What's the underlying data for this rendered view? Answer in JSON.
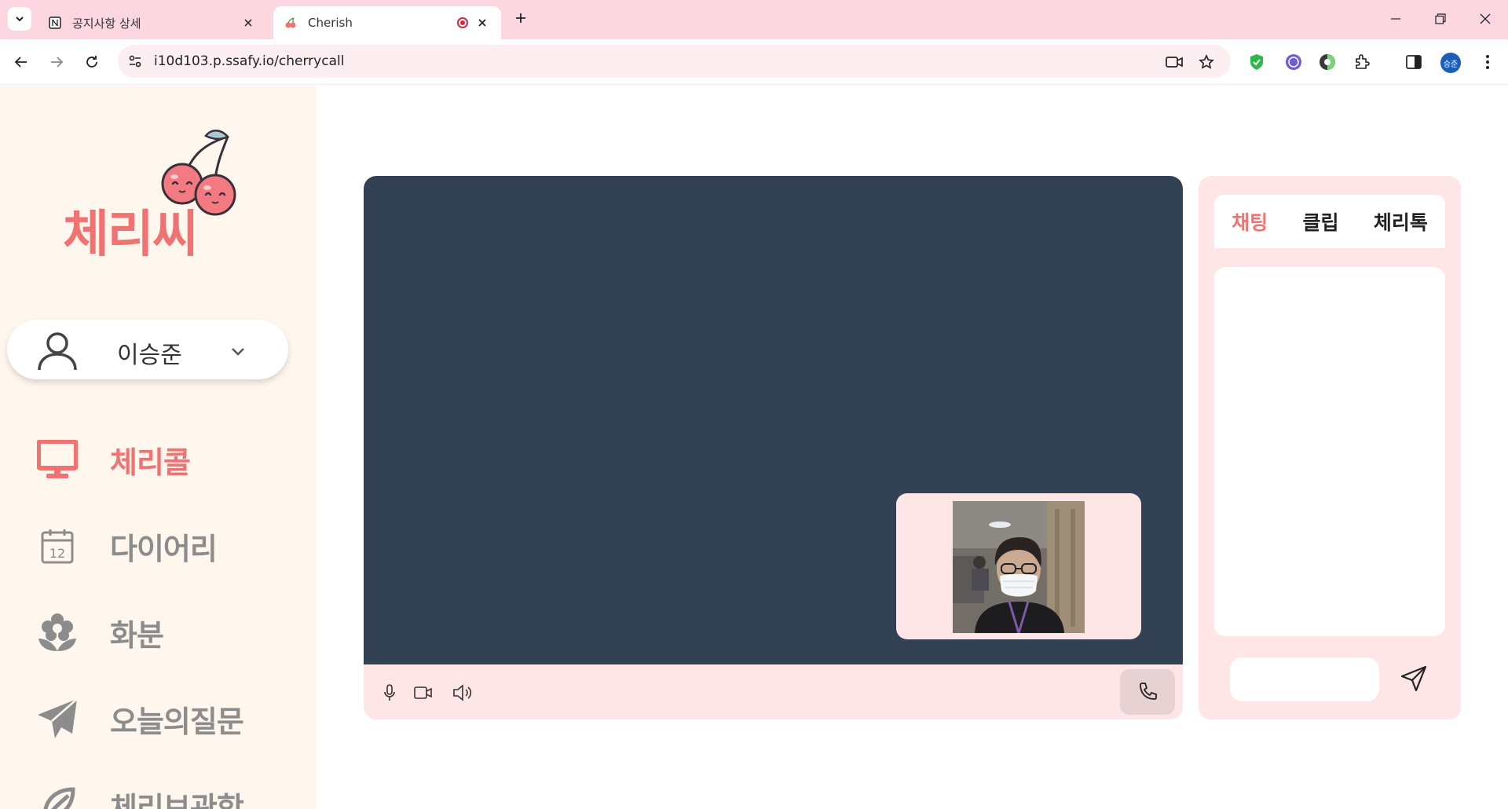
{
  "browser": {
    "tabs": [
      {
        "title": "공지사항 상세",
        "active": false
      },
      {
        "title": "Cherish",
        "active": true
      }
    ],
    "url": "i10d103.p.ssafy.io/cherrycall",
    "profile_initials": "승준"
  },
  "sidebar": {
    "logo_text": "체리씨",
    "user_name": "이승준",
    "nav": [
      {
        "label": "체리콜",
        "icon": "monitor-icon",
        "active": true
      },
      {
        "label": "다이어리",
        "icon": "calendar-icon",
        "active": false
      },
      {
        "label": "화분",
        "icon": "flower-icon",
        "active": false
      },
      {
        "label": "오늘의질문",
        "icon": "paper-plane-icon",
        "active": false
      },
      {
        "label": "체리보관함",
        "icon": "cherry-leaf-icon",
        "active": false
      }
    ]
  },
  "chat": {
    "tabs": [
      "채팅",
      "클립",
      "체리톡"
    ],
    "active_tab": "채팅",
    "input_value": ""
  },
  "colors": {
    "accent": "#f17272",
    "tabbar": "#fdd7df",
    "video_bg": "#334155",
    "panel_bg": "#ffe6e6",
    "sidebar_bg": "#fff7ee"
  }
}
